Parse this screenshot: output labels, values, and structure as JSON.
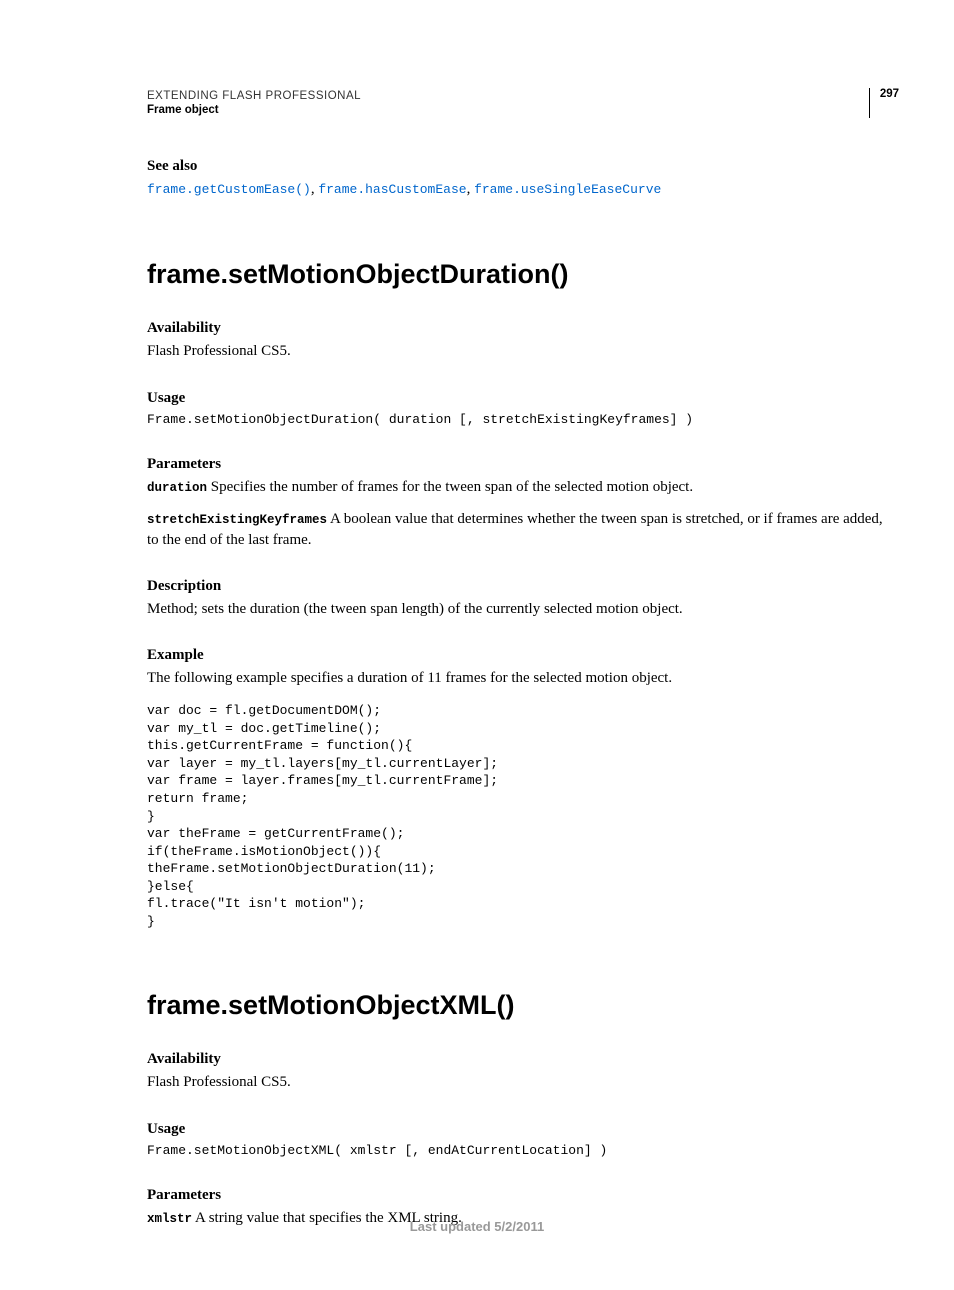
{
  "header": {
    "running": "EXTENDING FLASH PROFESSIONAL",
    "section": "Frame object",
    "page": "297"
  },
  "seeAlso": {
    "label": "See also",
    "links": {
      "a": "frame.getCustomEase()",
      "b": "frame.hasCustomEase",
      "c": "frame.useSingleEaseCurve"
    },
    "sep1": ", ",
    "sep2": ", "
  },
  "m1": {
    "title": "frame.setMotionObjectDuration()",
    "availLabel": "Availability",
    "availText": "Flash Professional CS5.",
    "usageLabel": "Usage",
    "usageCode": "Frame.setMotionObjectDuration( duration [, stretchExistingKeyframes] )",
    "paramsLabel": "Parameters",
    "p1name": "duration",
    "p1text": "  Specifies the number of frames for the tween span of the selected motion object.",
    "p2name": "stretchExistingKeyframes",
    "p2text": "  A boolean value that determines whether the tween span is stretched, or if frames are added, to the end of the last frame.",
    "descLabel": "Description",
    "descText": "Method; sets the duration (the tween span length) of the currently selected motion object.",
    "exLabel": "Example",
    "exText": "The following example specifies a duration of 11 frames for the selected motion object.",
    "exCode": "var doc = fl.getDocumentDOM();\nvar my_tl = doc.getTimeline();\nthis.getCurrentFrame = function(){\nvar layer = my_tl.layers[my_tl.currentLayer];\nvar frame = layer.frames[my_tl.currentFrame];\nreturn frame;\n}\nvar theFrame = getCurrentFrame();\nif(theFrame.isMotionObject()){\ntheFrame.setMotionObjectDuration(11);\n}else{\nfl.trace(\"It isn't motion\");\n}"
  },
  "m2": {
    "title": "frame.setMotionObjectXML()",
    "availLabel": "Availability",
    "availText": "Flash Professional CS5.",
    "usageLabel": "Usage",
    "usageCode": "Frame.setMotionObjectXML( xmlstr [, endAtCurrentLocation] )",
    "paramsLabel": "Parameters",
    "p1name": "xmlstr",
    "p1text": "  A string value that specifies the XML string."
  },
  "footer": "Last updated 5/2/2011"
}
